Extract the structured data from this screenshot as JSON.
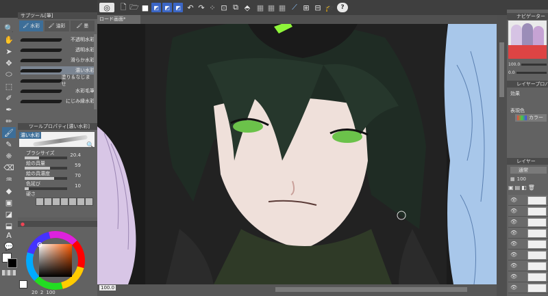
{
  "canvas_tab": {
    "label": "ロード画面*"
  },
  "subtool": {
    "title": "サブツール[筆]",
    "tabs": [
      {
        "label": "水彩"
      },
      {
        "label": "油彩"
      },
      {
        "label": "墨"
      }
    ],
    "brushes": [
      {
        "label": "不透明水彩"
      },
      {
        "label": "透明水彩"
      },
      {
        "label": "滑らか水彩"
      },
      {
        "label": "濃い水彩"
      },
      {
        "label": "塗り＆なじませ"
      },
      {
        "label": "水彩毛筆"
      },
      {
        "label": "にじみ縁水彩"
      }
    ],
    "selected_index": 3
  },
  "tool_property": {
    "title": "ツールプロパティ[濃い水彩]",
    "current_brush": "濃い水彩",
    "props": [
      {
        "label": "ブラシサイズ",
        "value": "20.4",
        "level": 0.34
      },
      {
        "label": "絵の具量",
        "value": "59",
        "level": 0.59
      },
      {
        "label": "絵の具濃度",
        "value": "70",
        "level": 0.7
      },
      {
        "label": "色延び",
        "value": "10",
        "level": 0.1
      },
      {
        "label": "硬さ",
        "value": ""
      }
    ]
  },
  "color_panel": {
    "fg_color": "#ffffff",
    "bg_color": "#000000",
    "readouts": [
      {
        "value": "20"
      },
      {
        "value": "2"
      },
      {
        "value": "100"
      }
    ]
  },
  "status": {
    "zoom": "100.0",
    "zoom2": "100.0"
  },
  "navigator": {
    "title": "ナビゲーター",
    "zoom": "100.0",
    "angle": "0.0"
  },
  "layer_property": {
    "title": "レイヤープロパティ",
    "effect_label": "効果",
    "display_label": "表現色",
    "display_value": "カラー"
  },
  "layers_panel": {
    "title": "レイヤー",
    "blend_mode": "通常",
    "opacity": "100"
  },
  "colors": {
    "accent": "#3d6e98",
    "panel": "#626262",
    "canvas_bg": "#1b1b1b"
  }
}
